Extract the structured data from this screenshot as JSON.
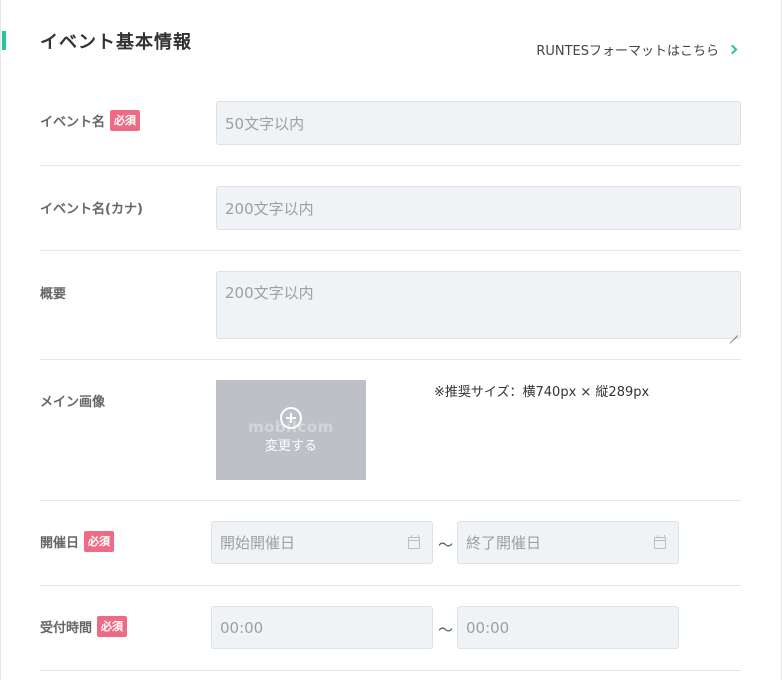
{
  "section": {
    "title": "イベント基本情報",
    "format_link": "RUNTESフォーマットはこちら"
  },
  "required_badge": "必須",
  "fields": {
    "event_name": {
      "label": "イベント名",
      "placeholder": "50文字以内"
    },
    "event_name_kana": {
      "label": "イベント名(カナ)",
      "placeholder": "200文字以内"
    },
    "summary": {
      "label": "概要",
      "placeholder": "200文字以内"
    },
    "main_image": {
      "label": "メイン画像",
      "button": "変更する",
      "watermark": "mobilcom",
      "note": "※推奨サイズ：横740px × 縦289px"
    },
    "event_date": {
      "label": "開催日",
      "start_placeholder": "開始開催日",
      "end_placeholder": "終了開催日",
      "separator": "～"
    },
    "reception_time": {
      "label": "受付時間",
      "start_placeholder": "00:00",
      "end_placeholder": "00:00",
      "separator": "～"
    }
  },
  "colors": {
    "accent": "#27c39a",
    "required": "#ee6b85",
    "input_bg": "#f0f3f6",
    "image_bg": "#bdc0c6"
  },
  "icons": {
    "link": "chevron-right-icon",
    "image": "plus-circle-icon",
    "date": "calendar-icon"
  }
}
